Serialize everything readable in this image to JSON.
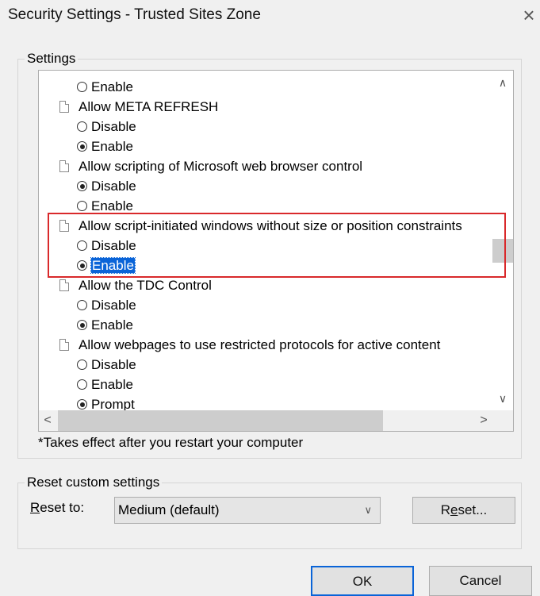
{
  "window": {
    "title": "Security Settings - Trusted Sites Zone",
    "close_glyph": "×"
  },
  "settings_group": {
    "legend": "Settings",
    "rows": [
      {
        "type": "option",
        "label": "Enable",
        "checked": false
      },
      {
        "type": "heading",
        "label": "Allow META REFRESH"
      },
      {
        "type": "option",
        "label": "Disable",
        "checked": false
      },
      {
        "type": "option",
        "label": "Enable",
        "checked": true
      },
      {
        "type": "heading",
        "label": "Allow scripting of Microsoft web browser control"
      },
      {
        "type": "option",
        "label": "Disable",
        "checked": true
      },
      {
        "type": "option",
        "label": "Enable",
        "checked": false
      },
      {
        "type": "heading",
        "label": "Allow script-initiated windows without size or position constraints"
      },
      {
        "type": "option",
        "label": "Disable",
        "checked": false
      },
      {
        "type": "option",
        "label": "Enable",
        "checked": true,
        "selected": true
      },
      {
        "type": "heading",
        "label": "Allow the TDC Control"
      },
      {
        "type": "option",
        "label": "Disable",
        "checked": false
      },
      {
        "type": "option",
        "label": "Enable",
        "checked": true
      },
      {
        "type": "heading",
        "label": "Allow webpages to use restricted protocols for active content"
      },
      {
        "type": "option",
        "label": "Disable",
        "checked": false
      },
      {
        "type": "option",
        "label": "Enable",
        "checked": false
      },
      {
        "type": "option",
        "label": "Prompt",
        "checked": true
      }
    ],
    "scroll_up_glyph": "∧",
    "scroll_down_glyph": "∨",
    "scroll_left_glyph": "<",
    "scroll_right_glyph": ">",
    "note": "*Takes effect after you restart your computer"
  },
  "reset_group": {
    "legend": "Reset custom settings",
    "reset_to_label_underlined": "R",
    "reset_to_label_rest": "eset to:",
    "dropdown_value": "Medium (default)",
    "dropdown_caret": "∨",
    "reset_button_pre": "R",
    "reset_button_underlined": "e",
    "reset_button_post": "set..."
  },
  "footer": {
    "ok_label": "OK",
    "cancel_label": "Cancel"
  },
  "colors": {
    "selection": "#0a64d8",
    "highlight_box": "#d9292b"
  },
  "icons": {
    "setting_heading": "document-icon",
    "option": "radio-icon"
  }
}
